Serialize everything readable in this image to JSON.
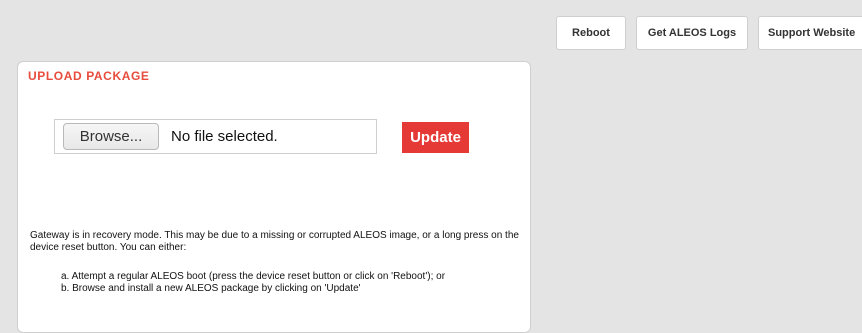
{
  "toolbar": {
    "reboot_label": "Reboot",
    "logs_label": "Get ALEOS Logs",
    "support_label": "Support Website"
  },
  "upload": {
    "title": "UPLOAD PACKAGE",
    "browse_label": "Browse...",
    "file_status": "No file selected.",
    "update_label": "Update"
  },
  "message": {
    "text": "Gateway is in recovery mode. This may be due to a missing or corrupted ALEOS image, or a long press on the device reset button. You can either:",
    "options": [
      "a. Attempt a regular ALEOS boot (press the device reset button or click on 'Reboot'); or",
      "b. Browse and install a new ALEOS package by clicking on 'Update'"
    ]
  },
  "colors": {
    "accent": "#e74c3c",
    "update_button": "#e53935",
    "background": "#e4e4e4"
  }
}
